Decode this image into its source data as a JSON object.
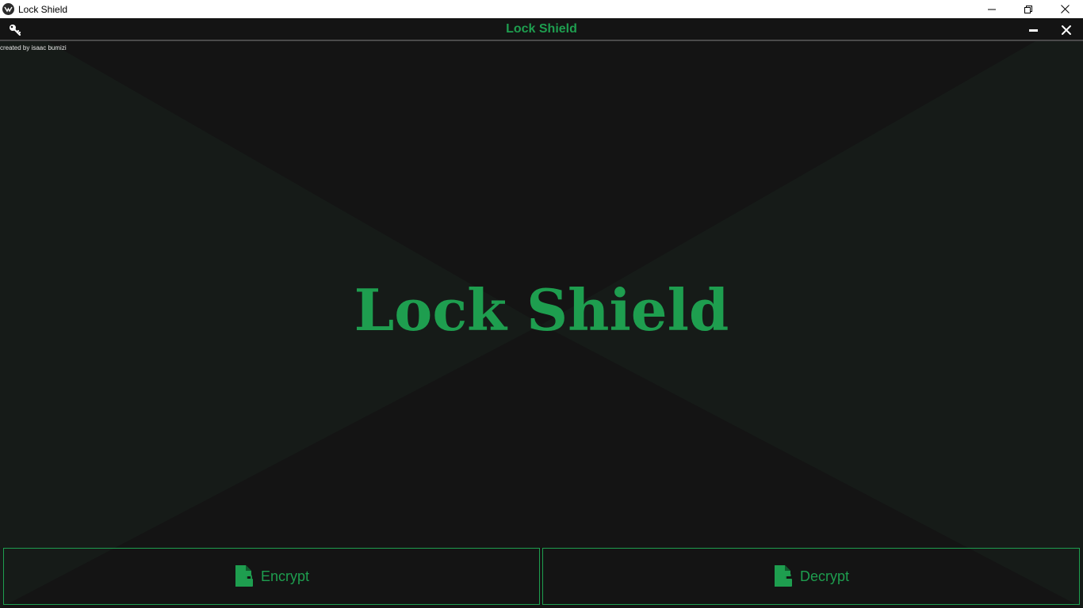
{
  "window": {
    "title": "Lock Shield",
    "icon": "app-logo-icon",
    "controls": [
      "minimize-icon",
      "restore-icon",
      "close-icon"
    ]
  },
  "toolbar": {
    "title": "Lock Shield",
    "left_icon": "key-icon",
    "right_icons": [
      "minimize-icon",
      "close-icon"
    ]
  },
  "main": {
    "credit": "created by isaac bumizi",
    "hero_title": "Lock Shield"
  },
  "actions": {
    "encrypt_label": "Encrypt",
    "encrypt_icon": "file-lock-icon",
    "decrypt_label": "Decrypt",
    "decrypt_icon": "file-unlock-icon"
  },
  "colors": {
    "accent": "#1e9e4f",
    "background": "#141414",
    "background_diagonal": "#161b18",
    "titlebar": "#ffffff"
  }
}
